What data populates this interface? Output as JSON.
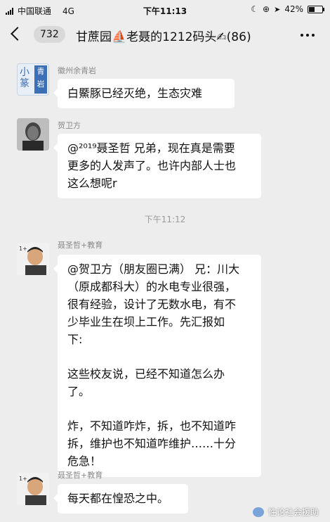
{
  "status_bar": {
    "carrier": "中国联通",
    "network": "4G",
    "time": "下午11:13",
    "battery": "42%",
    "battery_level": 0.42
  },
  "header": {
    "unread_count": "732",
    "title": "甘蔗园⛵老聂的1212码头✍(86)"
  },
  "messages": [
    {
      "sender": "徽州余青岩",
      "avatar_text": [
        "小",
        "青",
        "篆",
        "岩"
      ],
      "lines": [
        "白鱀豚已经灭绝，生态灾难"
      ]
    },
    {
      "sender": "贺卫方",
      "lines": [
        "@²⁰¹⁹聂圣哲 兄弟，现在真是需要",
        "更多的人发声了。也许内部人士也",
        "这么想呢r"
      ]
    },
    {
      "sender": "聂圣哲+教育",
      "avatar_text": [
        "1+"
      ],
      "paragraphs": [
        [
          "@贺卫方（朋友圈已满） 兄：川大",
          "（原成都科大）的水电专业很强，",
          "很有经验，设计了无数水电，有不",
          "少毕业生在坝上工作。先汇报如",
          "下:"
        ],
        [
          "这些校友说，已经不知道怎么办",
          "了。"
        ],
        [
          "炸，不知道咋炸，拆，也不知道咋",
          "拆，维护也不知道咋维护……十分",
          "危急！"
        ]
      ]
    },
    {
      "sender": "聂圣哲+教育",
      "avatar_text": [
        "1+"
      ],
      "lines": [
        "每天都在惶恐之中。"
      ]
    }
  ],
  "time_divider": "下午11:12",
  "watermark": "性论社会援助",
  "colors": {
    "background": "#ededed",
    "bubble": "#ffffff",
    "name_text": "#888888"
  }
}
